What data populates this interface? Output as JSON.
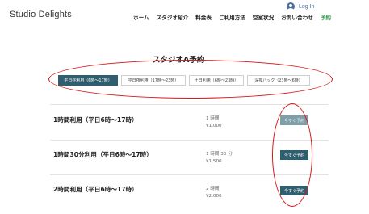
{
  "brand": "Studio Delights",
  "login_label": "Log In",
  "nav": {
    "items": [
      {
        "label": "ホーム"
      },
      {
        "label": "スタジオ紹介"
      },
      {
        "label": "料金表"
      },
      {
        "label": "ご利用方法"
      },
      {
        "label": "空室状況"
      },
      {
        "label": "お問い合わせ"
      },
      {
        "label": "予約"
      }
    ]
  },
  "page_title": "スタジオA予約",
  "tabs": [
    {
      "label": "平日昼利用（6時〜17時）"
    },
    {
      "label": "平日夜利用（17時〜23時）"
    },
    {
      "label": "土日利用（6時〜23時）"
    },
    {
      "label": "深夜パック（23時〜6時）"
    }
  ],
  "plans": [
    {
      "name": "1時間利用（平日6時〜17時）",
      "duration": "1 時間",
      "price": "¥1,000",
      "button": "今すぐ予約"
    },
    {
      "name": "1時間30分利用（平日6時〜17時）",
      "duration": "1 時間 30 分",
      "price": "¥1,500",
      "button": "今すぐ予約"
    },
    {
      "name": "2時間利用（平日6時〜17時）",
      "duration": "2 時間",
      "price": "¥2,000",
      "button": "今すぐ予約"
    }
  ],
  "colors": {
    "accent": "#2f5e6e",
    "accent_disabled": "#7f9ea8",
    "nav_active": "#2e9a4a",
    "annotation": "#d61a1a"
  }
}
